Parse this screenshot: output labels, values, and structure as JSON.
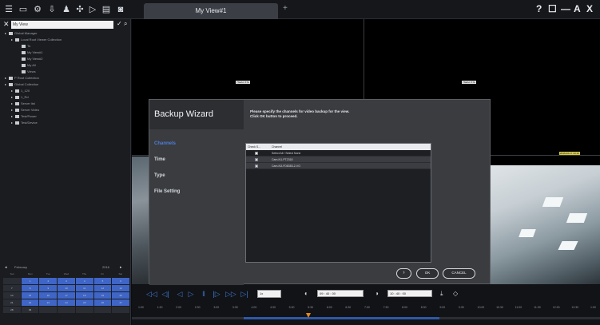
{
  "toolbar": {
    "icons": [
      "menu-icon",
      "monitor-icon",
      "settings-icon",
      "export-icon",
      "user-icon",
      "puzzle-icon",
      "play-icon",
      "sequence-icon",
      "camera-icon"
    ]
  },
  "tab": {
    "label": "My View#1",
    "add": "+"
  },
  "window": {
    "help": "?",
    "restore": "☐",
    "minimize": "—",
    "full": "A",
    "close": "X"
  },
  "search": {
    "value": "My View"
  },
  "tree": [
    {
      "label": "Global Manager",
      "level": 0
    },
    {
      "label": "Local Root Viewer Collection",
      "level": 1
    },
    {
      "label": "To",
      "level": 2
    },
    {
      "label": "My View#1",
      "level": 2
    },
    {
      "label": "My View#2",
      "level": 2
    },
    {
      "label": "My All",
      "level": 2
    },
    {
      "label": "Views",
      "level": 2
    },
    {
      "label": "P Root Collection",
      "level": 0
    },
    {
      "label": "Global Collection",
      "level": 0
    },
    {
      "label": "1_120",
      "level": 1
    },
    {
      "label": "1_Rd",
      "level": 1
    },
    {
      "label": "Server list",
      "level": 1
    },
    {
      "label": "Server Video",
      "level": 1
    },
    {
      "label": "Test/Power",
      "level": 1
    },
    {
      "label": "Test/Device",
      "level": 1
    }
  ],
  "calendar": {
    "month": "February",
    "year": "2016",
    "days": [
      "Sun",
      "Mon",
      "Tue",
      "Wed",
      "Thu",
      "Fri",
      "Sat"
    ],
    "cells": [
      "",
      "1",
      "2",
      "3",
      "4",
      "5",
      "6",
      "7",
      "8",
      "9",
      "10",
      "11",
      "12",
      "13",
      "14",
      "15",
      "16",
      "17",
      "18",
      "19",
      "20",
      "21",
      "22",
      "23",
      "24",
      "25",
      "26",
      "27",
      "28",
      "29",
      "",
      "",
      "",
      "",
      ""
    ],
    "highlighted": [
      1,
      2,
      3,
      4,
      5,
      6,
      8,
      9,
      10,
      11,
      12,
      13,
      15,
      16,
      17,
      18,
      19,
      20,
      22,
      23,
      24,
      25,
      26,
      27
    ]
  },
  "video": {
    "label_top_left": "7SEAC 5TA",
    "label_top_right": "7SEAC 5TA",
    "label_right_cam": "2016-02-17 10:10"
  },
  "wizard": {
    "title": "Backup Wizard",
    "instruction_line1": "Please specify the channels for video backup for the view.",
    "instruction_line2": "Click OK button to proceed.",
    "steps": [
      {
        "label": "Channels",
        "active": true
      },
      {
        "label": "Time",
        "active": false
      },
      {
        "label": "Type",
        "active": false
      },
      {
        "label": "File Setting",
        "active": false
      }
    ],
    "table_headers": {
      "check": "Check S...",
      "channel": "Channel"
    },
    "rows": [
      {
        "name": "Select All / Select None",
        "checked": false
      },
      {
        "name": "Cam-N1-PT2318",
        "checked": true
      },
      {
        "name": "Cam-N3-FD8383-2-VO",
        "checked": true
      }
    ],
    "buttons": {
      "next": "›",
      "ok": "OK",
      "cancel": "CANCEL"
    }
  },
  "playback": {
    "speed": "1x",
    "start_time": "09 : 40 : 00",
    "end_time": "10 : 40 : 00",
    "ticks": [
      "1:00",
      "1:30",
      "2:00",
      "2:30",
      "3:00",
      "3:30",
      "4:00",
      "4:30",
      "5:00",
      "5:30",
      "6:00",
      "6:30",
      "7:00",
      "7:30",
      "8:00",
      "8:30",
      "9:00",
      "9:30",
      "10:00",
      "10:30",
      "11:00",
      "11:30",
      "12:00",
      "12:30",
      "1:00"
    ]
  }
}
